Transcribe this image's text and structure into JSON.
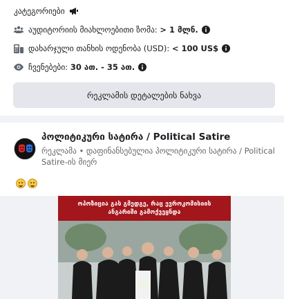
{
  "ad_info": {
    "categories_label": "კატეგორიები",
    "audience_label": "აუდიტორიის მიახლოებითი ზომა:",
    "audience_value": "> 1 მლნ.",
    "spend_label": "დახარჯული თანხის ოდენობა (USD):",
    "spend_value": "< 100 US$",
    "impressions_label": "ჩვენებები:",
    "impressions_value": "30 ათ. - 35 ათ.",
    "details_button": "რეკლამის დეტალების ნახვა"
  },
  "post": {
    "page_name": "პოლიტიკური სატირა / Political Satire",
    "subtitle": "რეკლამა • დაფინანსებულია პოლიტიკური სატირა / Political Satire-ის მიერ",
    "reactions": [
      "grin-emoji",
      "grin-emoji"
    ],
    "image": {
      "headline_line1": "ოპოზიცია გას გმედგე, რაც ევროკომისიის",
      "headline_line2": "ანგარიში გამოქვეყნდა"
    }
  },
  "colors": {
    "banner": "#a3161c",
    "button_bg": "#e4e6eb"
  }
}
